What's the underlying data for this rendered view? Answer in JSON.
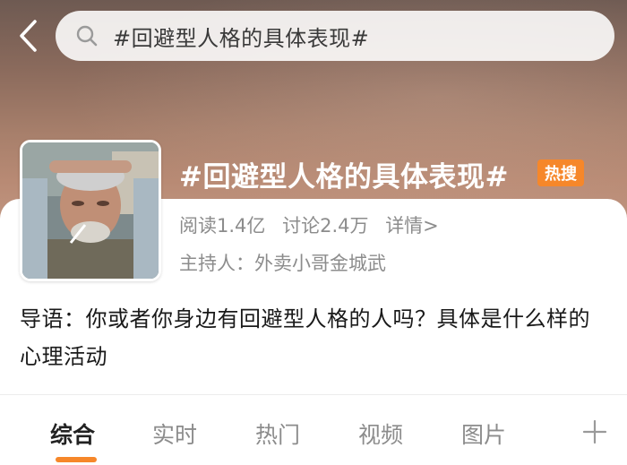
{
  "search": {
    "query": "#回避型人格的具体表现#"
  },
  "topic": {
    "title": "#回避型人格的具体表现#",
    "badge": "热搜",
    "reads": "阅读1.4亿",
    "discussions": "讨论2.4万",
    "detail": "详情>",
    "host": "主持人：外卖小哥金城武",
    "intro": "导语：你或者你身边有回避型人格的人吗？具体是什么样的心理活动"
  },
  "tabs": [
    {
      "label": "综合"
    },
    {
      "label": "实时"
    },
    {
      "label": "热门"
    },
    {
      "label": "视频"
    },
    {
      "label": "图片"
    }
  ],
  "colors": {
    "accent": "#f6872a",
    "muted_text": "#8c8c8c",
    "primary_text": "#1a1a1a"
  },
  "icons": {
    "back": "chevron-left-icon",
    "search": "search-icon",
    "add": "plus-icon"
  }
}
